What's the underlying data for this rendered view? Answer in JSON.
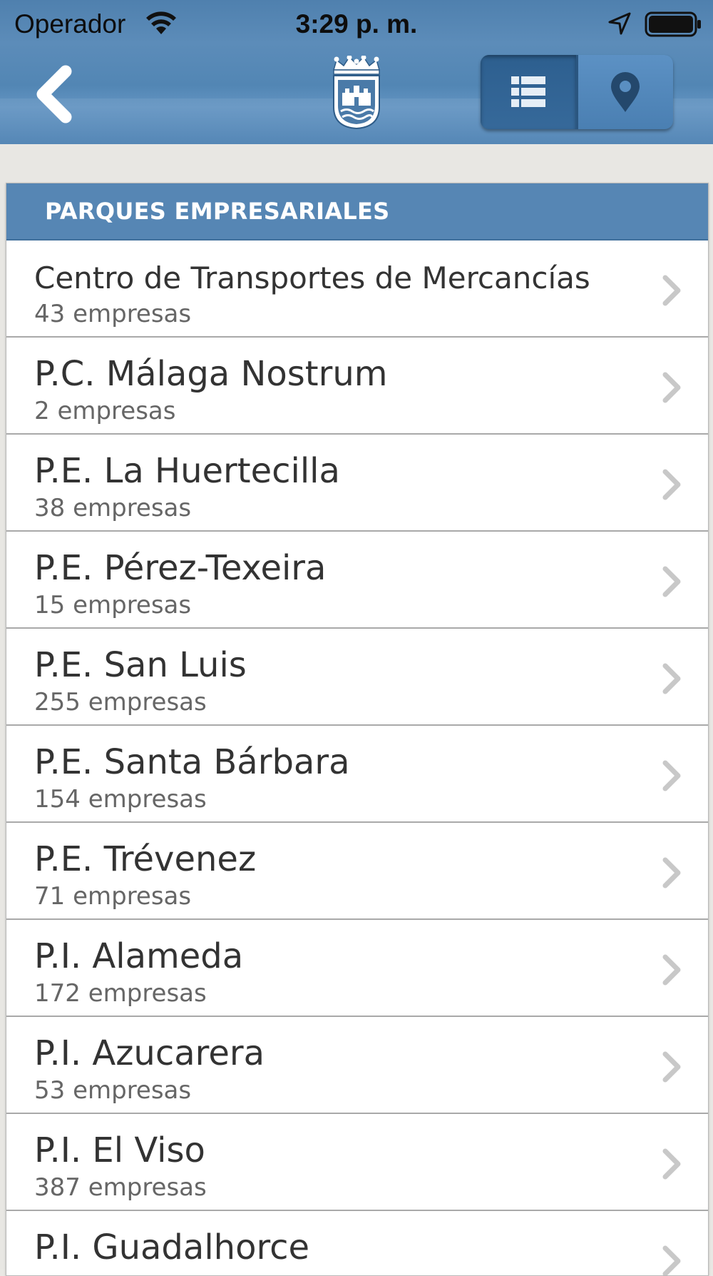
{
  "status_bar": {
    "carrier": "Operador",
    "time": "3:29 p. m.",
    "icons": [
      "wifi-icon",
      "location-arrow-icon",
      "battery-icon"
    ]
  },
  "navbar": {
    "back_icon": "chevron-left-icon",
    "logo": "city-crest-logo",
    "segments": [
      {
        "icon": "list-icon",
        "selected": true
      },
      {
        "icon": "map-pin-icon",
        "selected": false
      }
    ]
  },
  "list": {
    "section_title": "PARQUES EMPRESARIALES",
    "items": [
      {
        "title": "Centro de Transportes de Mercancías",
        "subtitle": "43 empresas"
      },
      {
        "title": "P.C. Málaga Nostrum",
        "subtitle": "2 empresas"
      },
      {
        "title": "P.E. La Huertecilla",
        "subtitle": "38 empresas"
      },
      {
        "title": "P.E. Pérez-Texeira",
        "subtitle": "15 empresas"
      },
      {
        "title": "P.E. San Luis",
        "subtitle": "255 empresas"
      },
      {
        "title": "P.E. Santa Bárbara",
        "subtitle": "154 empresas"
      },
      {
        "title": "P.E. Trévenez",
        "subtitle": "71 empresas"
      },
      {
        "title": "P.I. Alameda",
        "subtitle": "172 empresas"
      },
      {
        "title": "P.I. Azucarera",
        "subtitle": "53 empresas"
      },
      {
        "title": "P.I. El Viso",
        "subtitle": "387 empresas"
      },
      {
        "title": "P.I. Guadalhorce",
        "subtitle": ""
      }
    ]
  },
  "colors": {
    "navbar": "#5586b4",
    "section_header": "#5686b4",
    "segment_selected": "#2f6192",
    "segment_normal": "#5a8fc2",
    "background": "#e8e7e3",
    "title_text": "#333333",
    "subtitle_text": "#666666",
    "chevron": "#c8c8c8"
  }
}
